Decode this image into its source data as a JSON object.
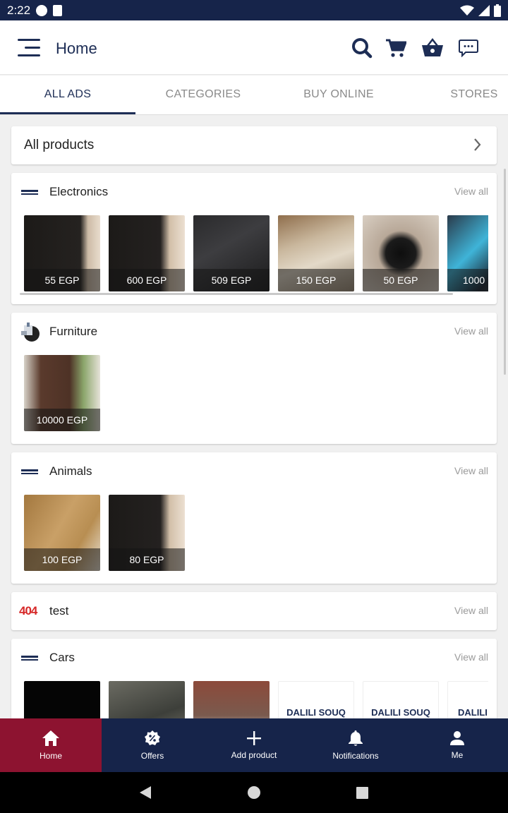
{
  "status_bar": {
    "time": "2:22"
  },
  "app_bar": {
    "title": "Home"
  },
  "tabs": [
    {
      "label": "ALL ADS",
      "active": true
    },
    {
      "label": "CATEGORIES",
      "active": false
    },
    {
      "label": "BUY ONLINE",
      "active": false
    },
    {
      "label": "STORES",
      "active": false
    }
  ],
  "all_products": {
    "label": "All products"
  },
  "view_all_label": "View all",
  "categories": {
    "electronics": {
      "name": "Electronics",
      "prices": [
        "55 EGP",
        "600 EGP",
        "509 EGP",
        "150 EGP",
        "50 EGP",
        "1000"
      ]
    },
    "furniture": {
      "name": "Furniture",
      "prices": [
        "10000 EGP"
      ]
    },
    "animals": {
      "name": "Animals",
      "prices": [
        "100 EGP",
        "80 EGP"
      ]
    },
    "test": {
      "name": "test",
      "logo_text": "404"
    },
    "cars": {
      "name": "Cars",
      "partial_brand_text": [
        "DALILI SOUQ",
        "DALILI SOUQ",
        "DALILI S"
      ]
    }
  },
  "bottom_nav": [
    {
      "label": "Home",
      "icon": "home-icon",
      "active": true
    },
    {
      "label": "Offers",
      "icon": "percent-badge-icon",
      "active": false
    },
    {
      "label": "Add product",
      "icon": "plus-icon",
      "active": false
    },
    {
      "label": "Notifications",
      "icon": "bell-icon",
      "active": false
    },
    {
      "label": "Me",
      "icon": "person-icon",
      "active": false
    }
  ],
  "colors": {
    "primary": "#16244a",
    "accent": "#8d1330",
    "title_text": "#1d2d55"
  }
}
